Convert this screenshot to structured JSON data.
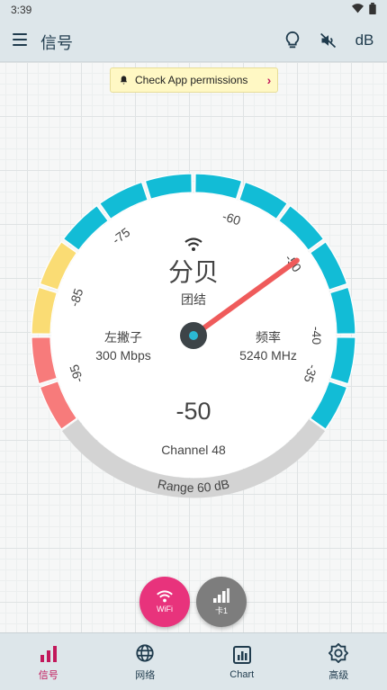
{
  "status_bar": {
    "time": "3:39"
  },
  "app_bar": {
    "title": "信号",
    "actions": [
      {
        "icon": "lightbulb-icon"
      },
      {
        "icon": "volume-off-icon"
      },
      {
        "icon": "db-unit",
        "label": "dB"
      }
    ]
  },
  "permission_banner": {
    "text": "Check App permissions"
  },
  "gauge": {
    "scale_min": -100,
    "scale_max": -30,
    "reading": -50,
    "reading_label": "-50",
    "unit_title": "分贝",
    "network_name": "团结",
    "left_label": "左撇子",
    "left_value": "300 Mbps",
    "right_label": "频率",
    "right_value": "5240 MHz",
    "channel": "Channel 48",
    "range_label": "Range 60 dB",
    "tick_labels": [
      "-95",
      "-85",
      "-75",
      "-60",
      "-50",
      "-40",
      "-35"
    ],
    "zone_colors": {
      "weak": "#f77b7b",
      "fair": "#fadc74",
      "good": "#12bcd6",
      "needle": "#ef5b5b",
      "range_track": "#d3d3d3"
    }
  },
  "fabs": [
    {
      "label": "WiFi",
      "color": "#e8337c"
    },
    {
      "label": "卡1",
      "color": "#7d7d7d"
    }
  ],
  "bottom_nav": [
    {
      "label": "信号",
      "active": true
    },
    {
      "label": "网络",
      "active": false
    },
    {
      "label": "Chart",
      "active": false
    },
    {
      "label": "高级",
      "active": false
    }
  ]
}
